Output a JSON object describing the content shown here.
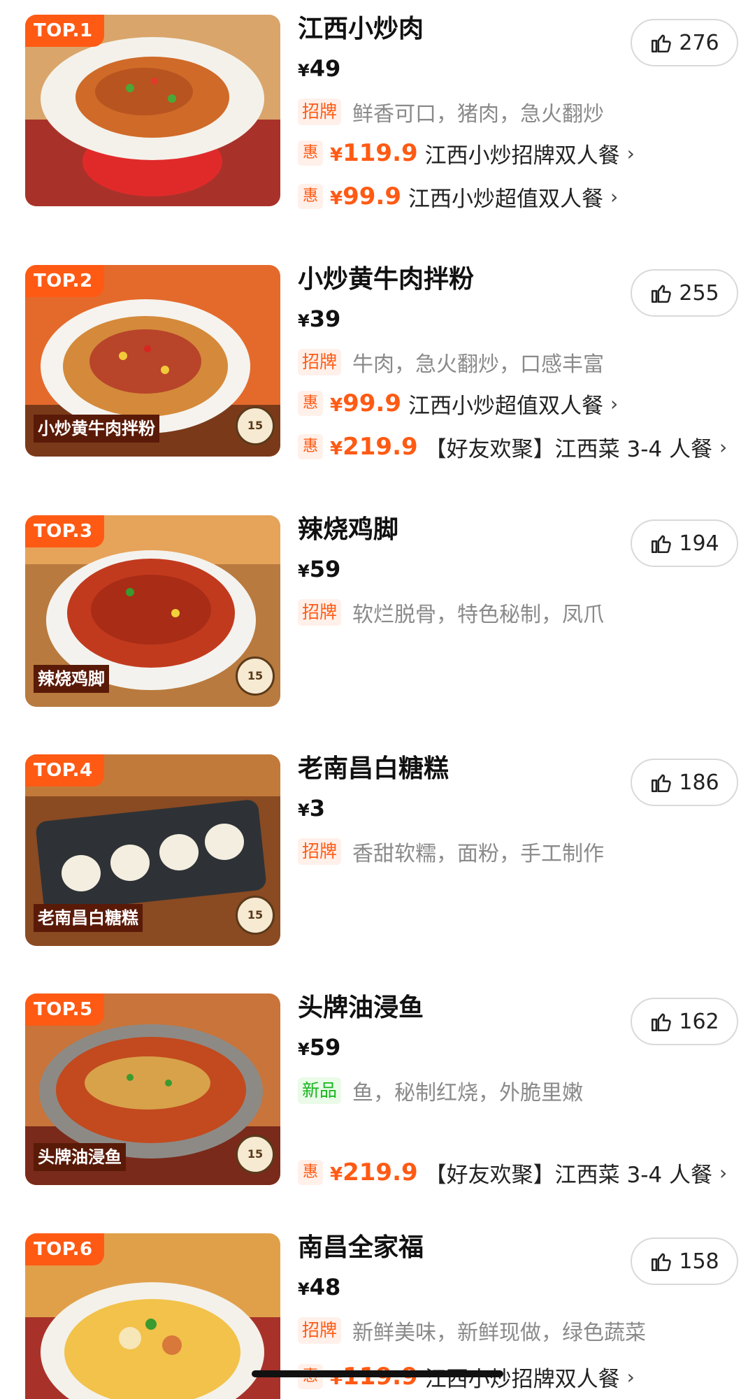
{
  "items": [
    {
      "rank": "TOP.1",
      "name": "江西小炒肉",
      "image_label": "",
      "yen": "¥",
      "price": "49",
      "likes": "276",
      "tag": "招牌",
      "tag_type": "sig",
      "desc": "鲜香可口，猪肉，急火翻炒",
      "deals": [
        {
          "badge": "惠",
          "yen": "¥",
          "price": "119.9",
          "name": "江西小炒招牌双人餐",
          "chevron": "›"
        },
        {
          "badge": "惠",
          "yen": "¥",
          "price": "99.9",
          "name": "江西小炒超值双人餐",
          "chevron": "›"
        }
      ]
    },
    {
      "rank": "TOP.2",
      "name": "小炒黄牛肉拌粉",
      "image_label": "小炒黄牛肉拌粉",
      "yen": "¥",
      "price": "39",
      "likes": "255",
      "tag": "招牌",
      "tag_type": "sig",
      "desc": "牛肉，急火翻炒，口感丰富",
      "deals": [
        {
          "badge": "惠",
          "yen": "¥",
          "price": "99.9",
          "name": "江西小炒超值双人餐",
          "chevron": "›"
        },
        {
          "badge": "惠",
          "yen": "¥",
          "price": "219.9",
          "name": "【好友欢聚】江西菜 3-4 人餐",
          "chevron": "›"
        }
      ]
    },
    {
      "rank": "TOP.3",
      "name": "辣烧鸡脚",
      "image_label": "辣烧鸡脚",
      "yen": "¥",
      "price": "59",
      "likes": "194",
      "tag": "招牌",
      "tag_type": "sig",
      "desc": "软烂脱骨，特色秘制，凤爪",
      "deals": []
    },
    {
      "rank": "TOP.4",
      "name": "老南昌白糖糕",
      "image_label": "老南昌白糖糕",
      "yen": "¥",
      "price": "3",
      "likes": "186",
      "tag": "招牌",
      "tag_type": "sig",
      "desc": "香甜软糯，面粉，手工制作",
      "deals": []
    },
    {
      "rank": "TOP.5",
      "name": "头牌油浸鱼",
      "image_label": "头牌油浸鱼",
      "yen": "¥",
      "price": "59",
      "likes": "162",
      "tag": "新品",
      "tag_type": "new",
      "desc": "鱼，秘制红烧，外脆里嫩",
      "deals": [
        {
          "badge": "惠",
          "yen": "¥",
          "price": "219.9",
          "name": "【好友欢聚】江西菜 3-4 人餐",
          "chevron": "›"
        }
      ]
    },
    {
      "rank": "TOP.6",
      "name": "南昌全家福",
      "image_label": "",
      "yen": "¥",
      "price": "48",
      "likes": "158",
      "tag": "招牌",
      "tag_type": "sig",
      "desc": "新鲜美味，新鲜现做，绿色蔬菜",
      "deals": [
        {
          "badge": "惠",
          "yen": "¥",
          "price": "119.9",
          "name": "江西小炒招牌双人餐",
          "chevron": "›"
        }
      ]
    }
  ],
  "colors": {
    "accent": "#ff5a14",
    "new_green": "#19b51e",
    "muted": "#8a8a8a"
  },
  "icons": {
    "like": "thumbs-up-icon",
    "chevron": "chevron-right-icon"
  }
}
